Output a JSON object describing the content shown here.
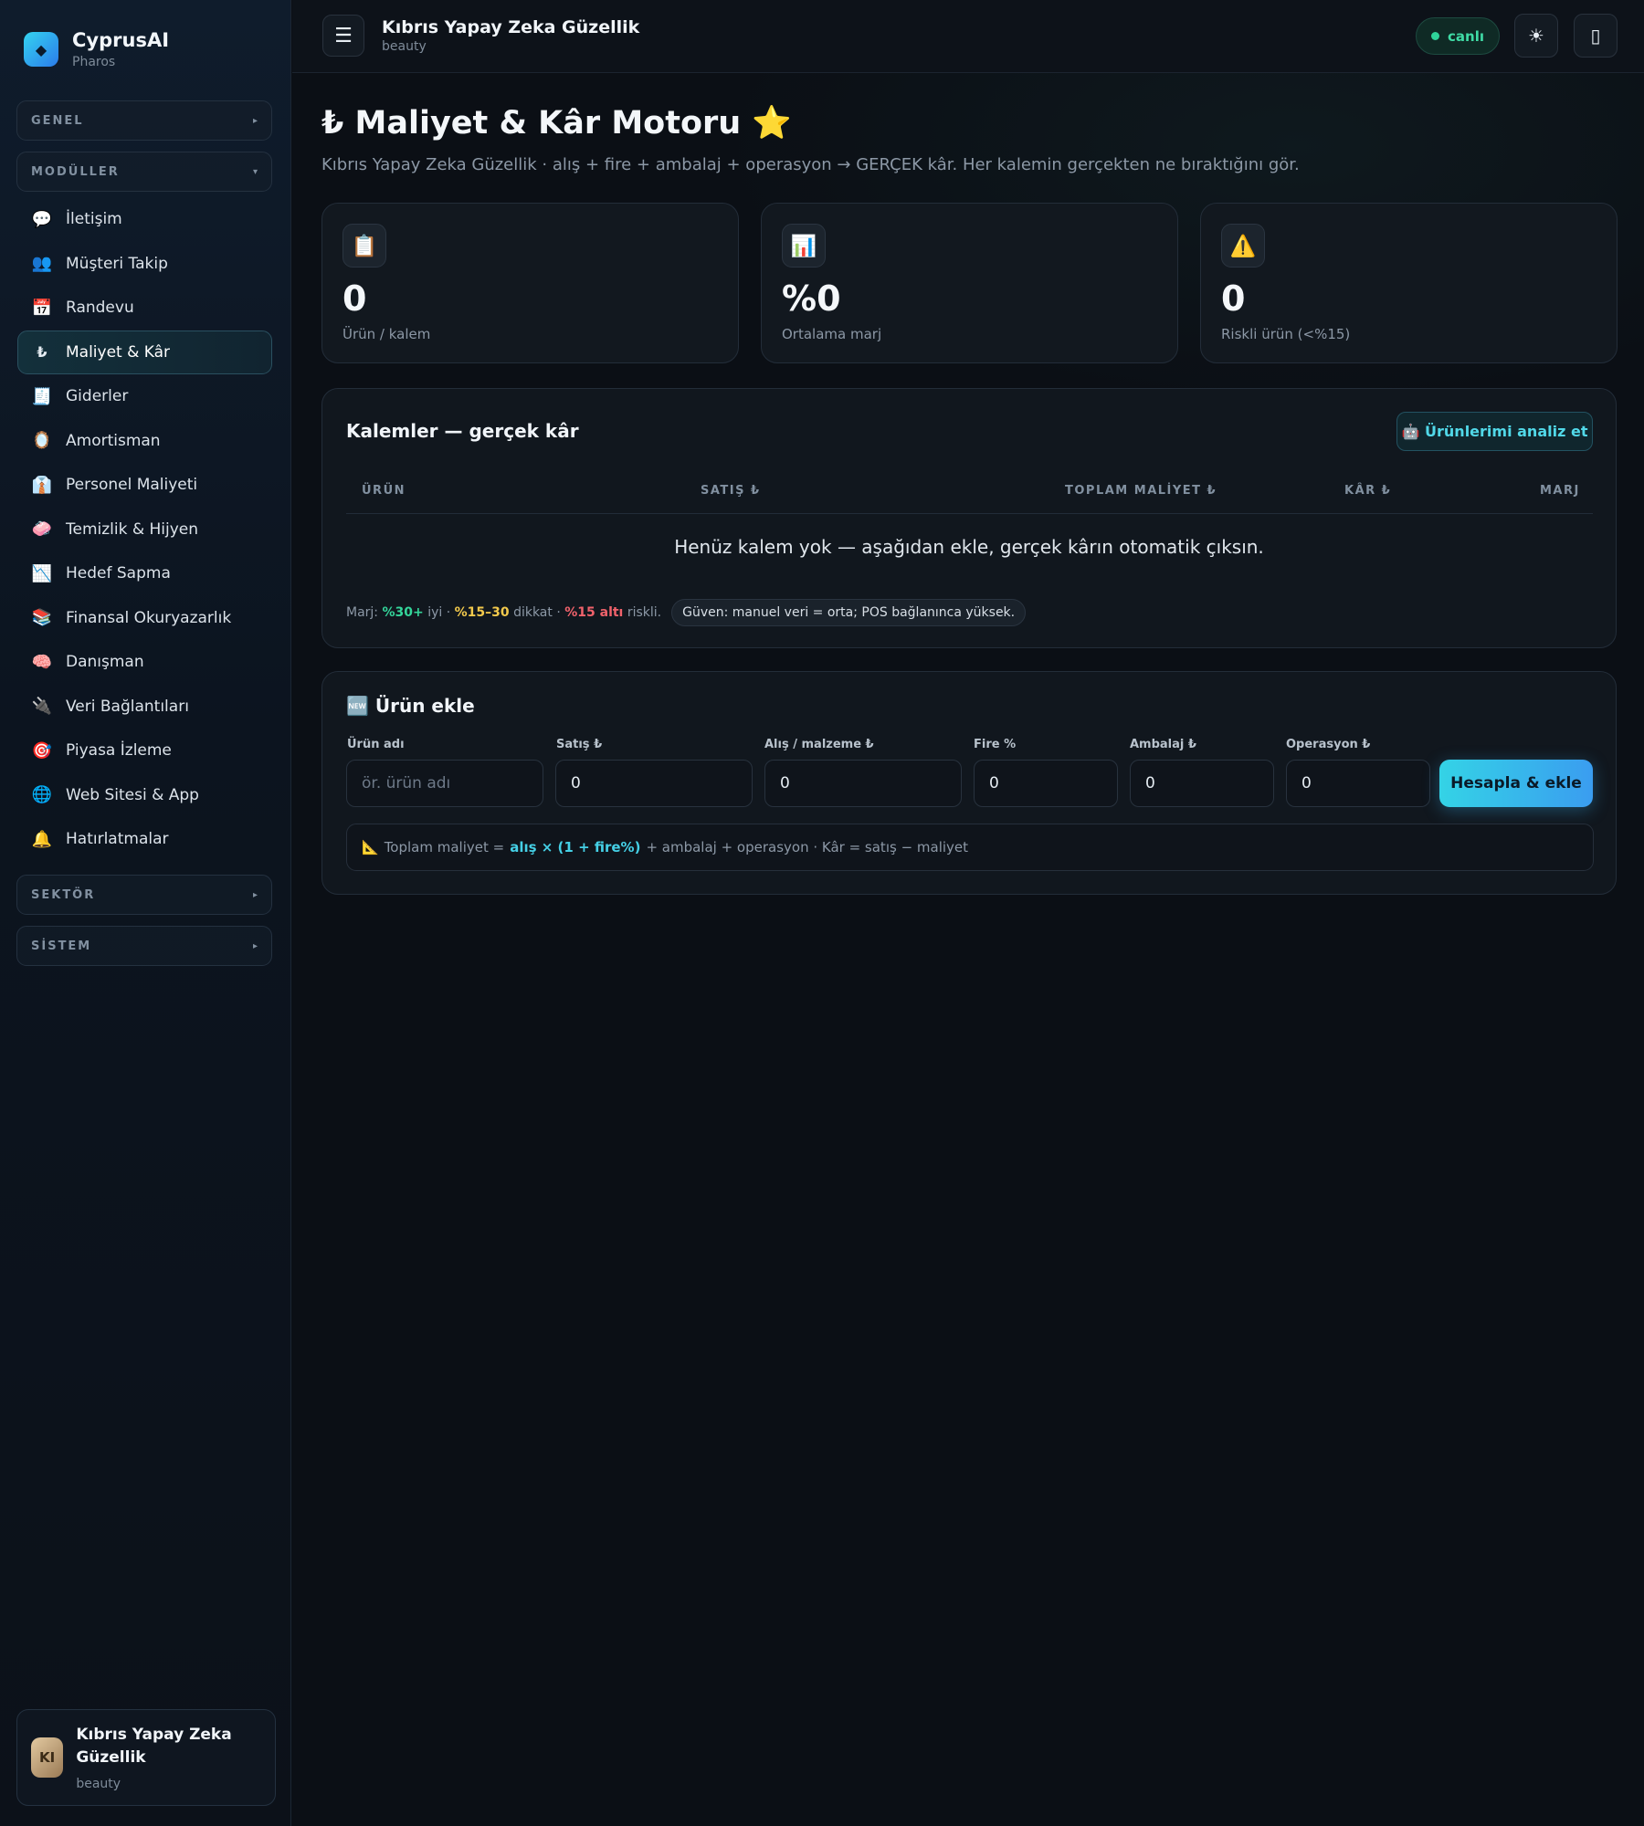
{
  "brand": {
    "name": "CyprusAI",
    "sub": "Pharos",
    "logo_icon": "◆"
  },
  "sidebar": {
    "groups": [
      {
        "label": "GENEL",
        "arrow": "▸"
      },
      {
        "label": "MODÜLLER",
        "arrow": "▾"
      },
      {
        "label": "SEKTÖR",
        "arrow": "▸"
      },
      {
        "label": "SİSTEM",
        "arrow": "▸"
      }
    ],
    "items": [
      {
        "icon": "💬",
        "label": "İletişim"
      },
      {
        "icon": "👥",
        "label": "Müşteri Takip"
      },
      {
        "icon": "📅",
        "label": "Randevu"
      },
      {
        "icon": "₺",
        "label": "Maliyet & Kâr",
        "active": true
      },
      {
        "icon": "🧾",
        "label": "Giderler"
      },
      {
        "icon": "🪞",
        "label": "Amortisman"
      },
      {
        "icon": "👔",
        "label": "Personel Maliyeti"
      },
      {
        "icon": "🧼",
        "label": "Temizlik & Hijyen"
      },
      {
        "icon": "📉",
        "label": "Hedef Sapma"
      },
      {
        "icon": "📚",
        "label": "Finansal Okuryazarlık"
      },
      {
        "icon": "🧠",
        "label": "Danışman"
      },
      {
        "icon": "🔌",
        "label": "Veri Bağlantıları"
      },
      {
        "icon": "🎯",
        "label": "Piyasa İzleme"
      },
      {
        "icon": "🌐",
        "label": "Web Sitesi & App"
      },
      {
        "icon": "🔔",
        "label": "Hatırlatmalar"
      }
    ],
    "user": {
      "initials": "KI",
      "name": "Kıbrıs Yapay Zeka Güzellik",
      "sub": "beauty"
    }
  },
  "topbar": {
    "menu_icon": "☰",
    "title": "Kıbrıs Yapay Zeka Güzellik",
    "sub": "beauty",
    "status": "canlı",
    "theme_icon": "☀",
    "panel_icon": "▯"
  },
  "page": {
    "title": "₺ Maliyet & Kâr Motoru ⭐",
    "description": "Kıbrıs Yapay Zeka Güzellik · alış + fire + ambalaj + operasyon → GERÇEK kâr. Her kalemin gerçekten ne bıraktığını gör."
  },
  "stats": [
    {
      "icon": "📋",
      "value": "0",
      "label": "Ürün / kalem"
    },
    {
      "icon": "📊",
      "value": "%0",
      "label": "Ortalama marj"
    },
    {
      "icon": "⚠️",
      "value": "0",
      "label": "Riskli ürün (<%15)"
    }
  ],
  "items_table": {
    "title": "Kalemler — gerçek kâr",
    "analyze_button": "🤖 Ürünlerimi analiz et",
    "columns": [
      "ÜRÜN",
      "SATIŞ ₺",
      "TOPLAM MALİYET ₺",
      "KÂR ₺",
      "MARJ"
    ],
    "empty": "Henüz kalem yok — aşağıdan ekle, gerçek kârın otomatik çıksın.",
    "legend": {
      "prefix": "Marj:",
      "good": "%30+",
      "good_text": "iyi ·",
      "warn": "%15–30",
      "warn_text": "dikkat ·",
      "bad": "%15 altı",
      "bad_text": "riskli.",
      "trust": "Güven: manuel veri = orta; POS bağlanınca yüksek."
    }
  },
  "add_form": {
    "title": "🆕 Ürün ekle",
    "fields": [
      {
        "label": "Ürün adı",
        "placeholder": "ör. ürün adı",
        "value": ""
      },
      {
        "label": "Satış ₺",
        "placeholder": "",
        "value": "0"
      },
      {
        "label": "Alış / malzeme ₺",
        "placeholder": "",
        "value": "0"
      },
      {
        "label": "Fire %",
        "placeholder": "",
        "value": "0"
      },
      {
        "label": "Ambalaj ₺",
        "placeholder": "",
        "value": "0"
      },
      {
        "label": "Operasyon ₺",
        "placeholder": "",
        "value": "0"
      }
    ],
    "submit": "Hesapla & ekle",
    "formula": {
      "icon": "📐",
      "prefix": "Toplam maliyet =",
      "highlight": "alış × (1 + fire%)",
      "suffix": "+ ambalaj + operasyon · Kâr = satış − maliyet"
    }
  }
}
